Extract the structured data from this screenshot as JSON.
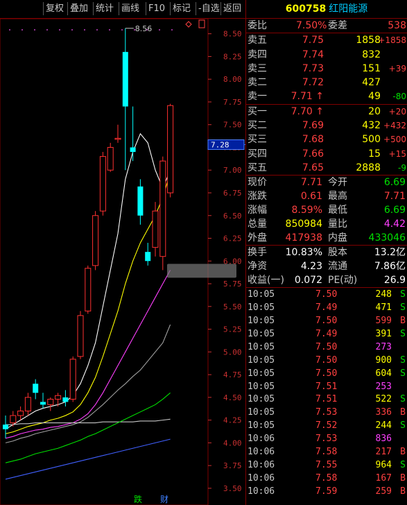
{
  "toolbar": {
    "buttons": [
      "复权",
      "叠加",
      "统计",
      "画线",
      "F10",
      "标记",
      "-自选",
      "返回"
    ]
  },
  "chart": {
    "price_axis": [
      "8.50",
      "8.25",
      "8.00",
      "7.75",
      "7.50",
      "7.25",
      "7.00",
      "6.75",
      "6.50",
      "6.25",
      "6.00",
      "5.75",
      "5.50",
      "5.25",
      "5.00",
      "4.75",
      "4.50",
      "4.25",
      "4.00",
      "3.75",
      "3.50"
    ],
    "high_label": "8.56",
    "current_price_tag": "7.28",
    "bottom_marks": [
      "跌",
      "财"
    ]
  },
  "chart_data": {
    "type": "candlestick",
    "ylim": [
      3.4,
      8.65
    ],
    "candles": [
      {
        "o": 4.2,
        "h": 4.3,
        "l": 4.05,
        "c": 4.15
      },
      {
        "o": 4.22,
        "h": 4.35,
        "l": 4.18,
        "c": 4.3
      },
      {
        "o": 4.3,
        "h": 4.4,
        "l": 4.25,
        "c": 4.35
      },
      {
        "o": 4.35,
        "h": 4.55,
        "l": 4.3,
        "c": 4.5
      },
      {
        "o": 4.65,
        "h": 4.7,
        "l": 4.48,
        "c": 4.55
      },
      {
        "o": 4.45,
        "h": 4.55,
        "l": 4.38,
        "c": 4.42
      },
      {
        "o": 4.42,
        "h": 4.5,
        "l": 4.35,
        "c": 4.48
      },
      {
        "o": 4.48,
        "h": 4.55,
        "l": 4.4,
        "c": 4.52
      },
      {
        "o": 4.5,
        "h": 4.58,
        "l": 4.4,
        "c": 4.45
      },
      {
        "o": 4.48,
        "h": 4.95,
        "l": 4.45,
        "c": 4.92
      },
      {
        "o": 4.95,
        "h": 5.45,
        "l": 4.92,
        "c": 5.4
      },
      {
        "o": 5.45,
        "h": 5.95,
        "l": 5.42,
        "c": 5.92
      },
      {
        "o": 5.95,
        "h": 6.55,
        "l": 5.9,
        "c": 6.5
      },
      {
        "o": 6.55,
        "h": 7.2,
        "l": 6.5,
        "c": 7.15
      },
      {
        "o": 7.0,
        "h": 7.3,
        "l": 6.98,
        "c": 7.25
      },
      {
        "o": 7.35,
        "h": 7.5,
        "l": 7.3,
        "c": 7.35
      },
      {
        "o": 8.3,
        "h": 8.56,
        "l": 7.0,
        "c": 7.7
      },
      {
        "o": 7.25,
        "h": 7.7,
        "l": 7.1,
        "c": 7.2
      },
      {
        "o": 6.82,
        "h": 6.9,
        "l": 6.4,
        "c": 6.5
      },
      {
        "o": 6.1,
        "h": 6.2,
        "l": 5.95,
        "c": 6.0
      },
      {
        "o": 6.15,
        "h": 6.65,
        "l": 6.05,
        "c": 6.55
      },
      {
        "o": 6.05,
        "h": 7.15,
        "l": 5.9,
        "c": 7.1
      },
      {
        "o": 6.75,
        "h": 7.73,
        "l": 6.7,
        "c": 7.71
      }
    ],
    "ma_lines": [
      {
        "color": "#ffffff",
        "values": [
          4.15,
          4.2,
          4.25,
          4.3,
          4.35,
          4.38,
          4.4,
          4.42,
          4.45,
          4.52,
          4.65,
          4.85,
          5.1,
          5.5,
          5.9,
          6.3,
          6.9,
          7.2,
          7.4,
          7.3,
          7.0,
          6.8,
          7.0
        ]
      },
      {
        "color": "#ffff00",
        "values": [
          4.1,
          4.12,
          4.15,
          4.18,
          4.2,
          4.22,
          4.25,
          4.27,
          4.3,
          4.34,
          4.42,
          4.55,
          4.72,
          4.95,
          5.2,
          5.45,
          5.75,
          6.0,
          6.2,
          6.35,
          6.5,
          6.7,
          6.97
        ]
      },
      {
        "color": "#ff40ff",
        "values": [
          4.05,
          4.07,
          4.1,
          4.12,
          4.14,
          4.15,
          4.17,
          4.18,
          4.2,
          4.22,
          4.26,
          4.32,
          4.42,
          4.55,
          4.7,
          4.85,
          5.0,
          5.15,
          5.3,
          5.45,
          5.6,
          5.75,
          5.9
        ]
      },
      {
        "color": "#a0a0a0",
        "values": [
          4.0,
          4.02,
          4.05,
          4.07,
          4.1,
          4.12,
          4.14,
          4.16,
          4.18,
          4.2,
          4.23,
          4.28,
          4.35,
          4.42,
          4.5,
          4.58,
          4.65,
          4.73,
          4.8,
          4.9,
          5.0,
          5.1,
          5.3
        ]
      },
      {
        "color": "#c8c8c8",
        "values": [
          4.2,
          4.2,
          4.21,
          4.21,
          4.22,
          4.22,
          4.22,
          4.22,
          4.22,
          4.22,
          4.22,
          4.22,
          4.22,
          4.23,
          4.23,
          4.23,
          4.23,
          4.23,
          4.24,
          4.24,
          4.24,
          4.25,
          4.26
        ]
      },
      {
        "color": "#00e000",
        "values": [
          3.78,
          3.8,
          3.82,
          3.85,
          3.88,
          3.9,
          3.92,
          3.94,
          3.97,
          4.0,
          4.03,
          4.07,
          4.1,
          4.14,
          4.18,
          4.22,
          4.26,
          4.3,
          4.34,
          4.38,
          4.42,
          4.48,
          4.55
        ]
      },
      {
        "color": "#4060ff",
        "values": [
          3.6,
          3.62,
          3.64,
          3.66,
          3.68,
          3.7,
          3.72,
          3.74,
          3.76,
          3.78,
          3.8,
          3.82,
          3.84,
          3.86,
          3.88,
          3.9,
          3.92,
          3.94,
          3.96,
          3.98,
          4.0,
          4.02,
          4.04
        ]
      }
    ]
  },
  "quote": {
    "code": "600758",
    "name": "红阳能源",
    "weibi_label": "委比",
    "weibi_value": "7.50%",
    "weicha_label": "委差",
    "weicha_value": "538",
    "asks": [
      {
        "label": "卖五",
        "price": "7.75",
        "vol": "1858",
        "chg": "+1858"
      },
      {
        "label": "卖四",
        "price": "7.74",
        "vol": "832",
        "chg": ""
      },
      {
        "label": "卖三",
        "price": "7.73",
        "vol": "151",
        "chg": "+39"
      },
      {
        "label": "卖二",
        "price": "7.72",
        "vol": "427",
        "chg": ""
      },
      {
        "label": "卖一",
        "price": "7.71 ↑",
        "vol": "49",
        "chg": "-80"
      }
    ],
    "bids": [
      {
        "label": "买一",
        "price": "7.70 ↑",
        "vol": "20",
        "chg": "+20"
      },
      {
        "label": "买二",
        "price": "7.69",
        "vol": "432",
        "chg": "+432"
      },
      {
        "label": "买三",
        "price": "7.68",
        "vol": "500",
        "chg": "+500"
      },
      {
        "label": "买四",
        "price": "7.66",
        "vol": "15",
        "chg": "+15"
      },
      {
        "label": "买五",
        "price": "7.65",
        "vol": "2888",
        "chg": "-9"
      }
    ],
    "stats": [
      {
        "l1": "现价",
        "v1": "7.71",
        "l2": "今开",
        "v2": "6.69"
      },
      {
        "l1": "涨跌",
        "v1": "0.61",
        "l2": "最高",
        "v2": "7.71"
      },
      {
        "l1": "涨幅",
        "v1": "8.59%",
        "l2": "最低",
        "v2": "6.69"
      },
      {
        "l1": "总量",
        "v1": "850984",
        "l2": "量比",
        "v2": "4.42"
      },
      {
        "l1": "外盘",
        "v1": "417938",
        "l2": "内盘",
        "v2": "433046"
      }
    ],
    "stats2": [
      {
        "l1": "换手",
        "v1": "10.83%",
        "l2": "股本",
        "v2": "13.2亿"
      },
      {
        "l1": "净资",
        "v1": "4.23",
        "l2": "流通",
        "v2": "7.86亿"
      },
      {
        "l1": "收益(一)",
        "v1": "0.072",
        "l2": "PE(动)",
        "v2": "26.9"
      }
    ]
  },
  "ticks": [
    {
      "time": "10:05",
      "price": "7.50",
      "vol": "248",
      "flag": "S"
    },
    {
      "time": "10:05",
      "price": "7.49",
      "vol": "471",
      "flag": "S"
    },
    {
      "time": "10:05",
      "price": "7.50",
      "vol": "599",
      "flag": "B"
    },
    {
      "time": "10:05",
      "price": "7.49",
      "vol": "391",
      "flag": "S"
    },
    {
      "time": "10:05",
      "price": "7.50",
      "vol": "273",
      "flag": ""
    },
    {
      "time": "10:05",
      "price": "7.50",
      "vol": "900",
      "flag": "S"
    },
    {
      "time": "10:05",
      "price": "7.50",
      "vol": "604",
      "flag": "S"
    },
    {
      "time": "10:05",
      "price": "7.51",
      "vol": "253",
      "flag": ""
    },
    {
      "time": "10:05",
      "price": "7.51",
      "vol": "522",
      "flag": "S"
    },
    {
      "time": "10:05",
      "price": "7.53",
      "vol": "336",
      "flag": "B"
    },
    {
      "time": "10:05",
      "price": "7.52",
      "vol": "244",
      "flag": "S"
    },
    {
      "time": "10:06",
      "price": "7.53",
      "vol": "836",
      "flag": ""
    },
    {
      "time": "10:06",
      "price": "7.58",
      "vol": "217",
      "flag": "B"
    },
    {
      "time": "10:06",
      "price": "7.55",
      "vol": "964",
      "flag": "S"
    },
    {
      "time": "10:06",
      "price": "7.58",
      "vol": "167",
      "flag": "B"
    },
    {
      "time": "10:06",
      "price": "7.59",
      "vol": "259",
      "flag": "B"
    }
  ]
}
